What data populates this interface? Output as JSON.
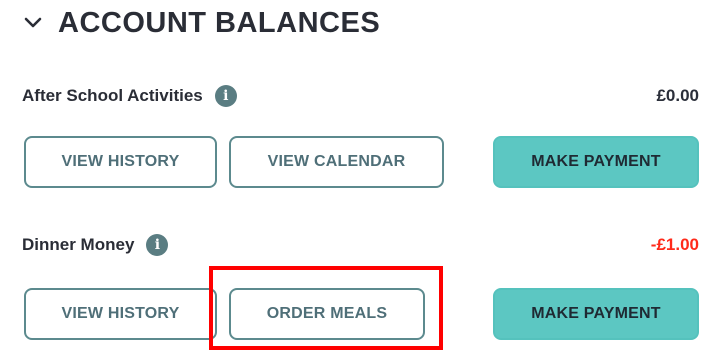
{
  "section": {
    "title": "ACCOUNT BALANCES",
    "toggle_icon": "chevron-down-icon"
  },
  "accounts": [
    {
      "name": "After School Activities",
      "info_icon": "info-icon",
      "balance": "£0.00",
      "balance_color": "#2a2d36",
      "buttons": {
        "history": "VIEW HISTORY",
        "secondary": "VIEW CALENDAR",
        "payment": "MAKE PAYMENT"
      }
    },
    {
      "name": "Dinner Money",
      "info_icon": "info-icon",
      "balance": "-£1.00",
      "balance_color": "#ff2a1a",
      "buttons": {
        "history": "VIEW HISTORY",
        "secondary": "ORDER MEALS",
        "payment": "MAKE PAYMENT"
      }
    }
  ],
  "annotation": {
    "highlight_color": "#ff0000",
    "highlighted": "ORDER MEALS"
  },
  "colors": {
    "outline_button": "#5c8a8e",
    "solid_button": "#5cc7c2",
    "info_icon_bg": "#5a7d82"
  }
}
